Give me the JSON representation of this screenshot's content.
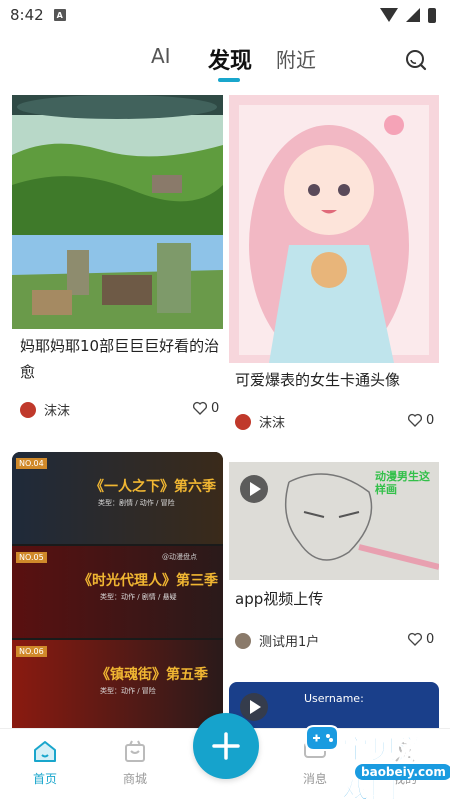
{
  "status_bar": {
    "time": "8:42",
    "app_badge": "A"
  },
  "top_tabs": [
    {
      "label": "AI"
    },
    {
      "label": "发现"
    },
    {
      "label": "附近"
    }
  ],
  "feed": [
    {
      "title": "妈耶妈耶10部巨巨巨好看的治愈",
      "author": "沫沫",
      "likes": "0"
    },
    {
      "title": "可爱爆表的女生卡通头像",
      "author": "沫沫",
      "likes": "0"
    },
    {
      "posters": [
        {
          "tag": "NO.04",
          "title": "《一人之下》第六季",
          "meta": "类型：剧情 / 动作 / 冒险"
        },
        {
          "tag": "NO.05",
          "title": "《时光代理人》第三季",
          "meta": "类型：动作 / 剧情 / 悬疑"
        },
        {
          "tag": "NO.06",
          "title": "《镇魂街》第五季",
          "meta": "类型：动作 / 冒险"
        }
      ],
      "poster_watermark": "@动漫盘点"
    },
    {
      "title": "app视频上传",
      "author": "测试用1户",
      "likes": "0",
      "video_overlay": "动漫男生这样画"
    },
    {
      "video_text": "Username:"
    }
  ],
  "bottom_nav": [
    {
      "label": "首页"
    },
    {
      "label": "商城"
    },
    {
      "label": "消息"
    },
    {
      "label": "我的"
    }
  ],
  "watermark": {
    "text": "宝贝游戏网",
    "url": "baobeiy.com"
  },
  "colors": {
    "accent": "#19a6cc",
    "fab": "#16a3cc",
    "watermark": "#1a9be0"
  }
}
